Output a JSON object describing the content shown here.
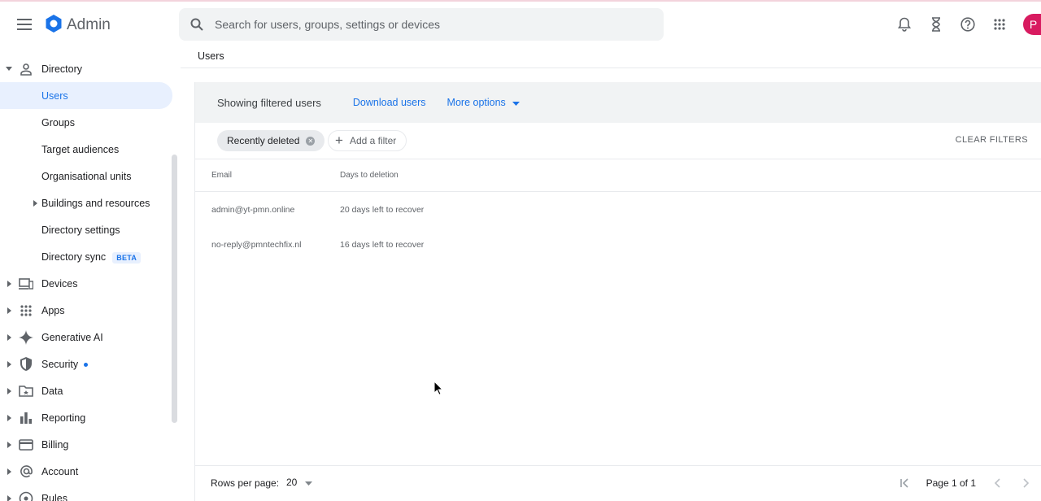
{
  "header": {
    "brand": "Admin",
    "search_placeholder": "Search for users, groups, settings or devices",
    "avatar_initial": "P"
  },
  "sidebar": {
    "directory": "Directory",
    "items": [
      {
        "label": "Users"
      },
      {
        "label": "Groups"
      },
      {
        "label": "Target audiences"
      },
      {
        "label": "Organisational units"
      },
      {
        "label": "Buildings and resources"
      },
      {
        "label": "Directory settings"
      },
      {
        "label": "Directory sync",
        "badge": "BETA"
      }
    ],
    "sections": [
      {
        "label": "Devices"
      },
      {
        "label": "Apps"
      },
      {
        "label": "Generative AI"
      },
      {
        "label": "Security"
      },
      {
        "label": "Data"
      },
      {
        "label": "Reporting"
      },
      {
        "label": "Billing"
      },
      {
        "label": "Account"
      },
      {
        "label": "Rules"
      }
    ]
  },
  "breadcrumb": "Users",
  "panel": {
    "title": "Showing filtered users",
    "download": "Download users",
    "more_options": "More options",
    "filter_chip": "Recently deleted",
    "add_filter": "Add a filter",
    "clear_filters": "CLEAR FILTERS",
    "columns": [
      "Email",
      "Days to deletion"
    ],
    "rows": [
      {
        "email": "admin@yt-pmn.online",
        "days": "20 days left to recover"
      },
      {
        "email": "no-reply@pmntechfix.nl",
        "days": "16 days left to recover"
      }
    ]
  },
  "footer": {
    "rows_per_page_label": "Rows per page:",
    "rows_per_page_value": "20",
    "page_text": "Page 1 of 1"
  },
  "colors": {
    "accent": "#1a73e8",
    "avatar": "#d81b60",
    "panel_header": "#f1f3f4"
  }
}
